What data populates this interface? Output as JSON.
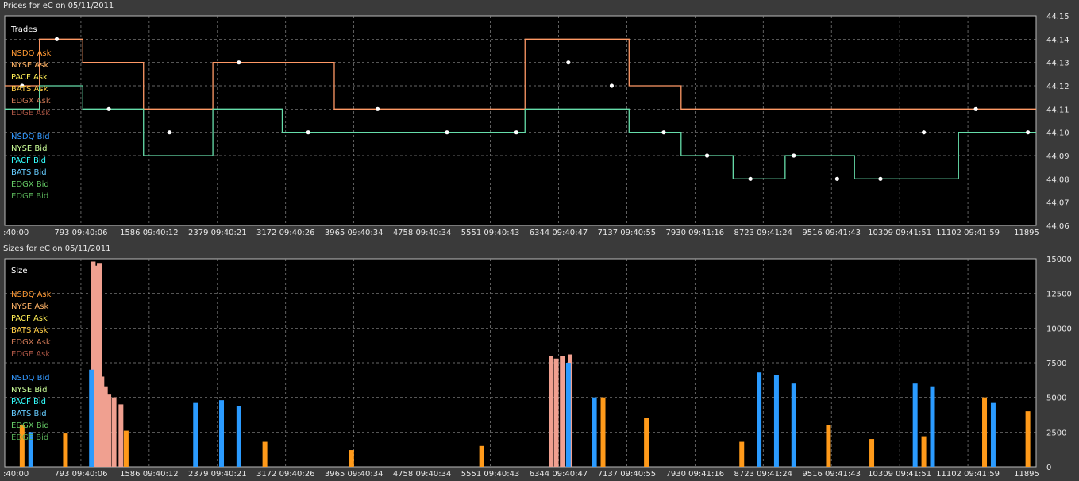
{
  "prices_panel": {
    "title": "Prices for  eC  on  05/11/2011",
    "section_label": "Trades",
    "legend_ask": [
      {
        "label": "NSDQ Ask",
        "color": "#ff9933"
      },
      {
        "label": "NYSE Ask",
        "color": "#ffb366"
      },
      {
        "label": "PACF Ask",
        "color": "#ffee55"
      },
      {
        "label": "BATS Ask",
        "color": "#ffcc44"
      },
      {
        "label": "EDGX Ask",
        "color": "#cc7755"
      },
      {
        "label": "EDGE Ask",
        "color": "#aa5544"
      }
    ],
    "legend_bid": [
      {
        "label": "NSDQ Bid",
        "color": "#3399ff"
      },
      {
        "label": "NYSE Bid",
        "color": "#ccff99"
      },
      {
        "label": "PACF Bid",
        "color": "#33ffff"
      },
      {
        "label": "BATS Bid",
        "color": "#66ccff"
      },
      {
        "label": "EDGX Bid",
        "color": "#66cc66"
      },
      {
        "label": "EDGE Bid",
        "color": "#55aa55"
      }
    ]
  },
  "sizes_panel": {
    "title": "Sizes for  eC  on  05/11/2011",
    "section_label": "Size"
  },
  "x_tick_labels": [
    ":40:00",
    "793 09:40:06",
    "1586 09:40:12",
    "2379 09:40:21",
    "3172 09:40:26",
    "3965 09:40:34",
    "4758 09:40:34",
    "5551 09:40:43",
    "6344 09:40:47",
    "7137 09:40:55",
    "7930 09:41:16",
    "8723 09:41:24",
    "9516 09:41:43",
    "10309 09:41:51",
    "11102 09:41:59",
    "11895"
  ],
  "chart_data": [
    {
      "type": "line",
      "title": "Prices for  eC  on  05/11/2011",
      "x_range": [
        0,
        11895
      ],
      "ylim": [
        44.06,
        44.15
      ],
      "yticks": [
        "44.15",
        "44.14",
        "44.13",
        "44.12",
        "44.11",
        "44.10",
        "44.09",
        "44.08",
        "44.07",
        "44.06"
      ],
      "grid": true,
      "legend_placement": "left",
      "series": [
        {
          "name": "Ask",
          "x": [
            0,
            400,
            900,
            1600,
            2400,
            3200,
            3800,
            4600,
            5400,
            6000,
            6800,
            7200,
            7800,
            8400,
            9000,
            9800,
            10400,
            11000,
            11600
          ],
          "values": [
            44.12,
            44.14,
            44.13,
            44.11,
            44.13,
            44.13,
            44.11,
            44.11,
            44.11,
            44.14,
            44.14,
            44.12,
            44.11,
            44.11,
            44.11,
            44.11,
            44.11,
            44.11,
            44.11
          ]
        },
        {
          "name": "Bid",
          "x": [
            0,
            400,
            900,
            1600,
            2400,
            3200,
            3800,
            4600,
            5400,
            6000,
            6800,
            7200,
            7800,
            8400,
            9000,
            9800,
            10400,
            11000,
            11600
          ],
          "values": [
            44.11,
            44.12,
            44.11,
            44.09,
            44.11,
            44.1,
            44.1,
            44.1,
            44.1,
            44.11,
            44.11,
            44.1,
            44.09,
            44.08,
            44.09,
            44.08,
            44.08,
            44.1,
            44.1
          ]
        },
        {
          "name": "Trades",
          "x": [
            200,
            600,
            1200,
            1900,
            2700,
            3500,
            4300,
            5100,
            5900,
            6500,
            7000,
            7600,
            8100,
            8600,
            9100,
            9600,
            10100,
            10600,
            11200,
            11800
          ],
          "values": [
            44.12,
            44.14,
            44.11,
            44.1,
            44.13,
            44.1,
            44.11,
            44.1,
            44.1,
            44.13,
            44.12,
            44.1,
            44.09,
            44.08,
            44.09,
            44.08,
            44.08,
            44.1,
            44.11,
            44.1
          ]
        }
      ]
    },
    {
      "type": "bar",
      "title": "Sizes for  eC  on  05/11/2011",
      "x_range": [
        0,
        11895
      ],
      "ylim": [
        0,
        15000
      ],
      "yticks": [
        "15000",
        "12500",
        "10000",
        "7500",
        "5000",
        "2500",
        "0"
      ],
      "grid": true,
      "legend_placement": "left",
      "series": [
        {
          "name": "NYSE Ask",
          "x": [
            1020,
            1060,
            1090,
            1120,
            1160,
            1200,
            1260,
            1340,
            6300,
            6360,
            6430,
            6520
          ],
          "values": [
            14800,
            14500,
            14700,
            6500,
            5800,
            5200,
            5000,
            4500,
            8000,
            7800,
            8000,
            8100
          ]
        },
        {
          "name": "NSDQ Bid",
          "x": [
            300,
            1000,
            2200,
            2500,
            2700,
            6500,
            6800,
            8700,
            8900,
            9100,
            10500,
            10700,
            11400
          ],
          "values": [
            2500,
            7000,
            4600,
            4800,
            4400,
            7500,
            5000,
            6800,
            6600,
            6000,
            6000,
            5800,
            4600
          ]
        },
        {
          "name": "NSDQ Ask",
          "x": [
            200,
            700,
            1400,
            3000,
            4000,
            5500,
            6900,
            7400,
            8500,
            9500,
            10000,
            10600,
            11300,
            11800
          ],
          "values": [
            3000,
            2400,
            2600,
            1800,
            1200,
            1500,
            5000,
            3500,
            1800,
            3000,
            2000,
            2200,
            5000,
            4000
          ]
        }
      ]
    }
  ]
}
